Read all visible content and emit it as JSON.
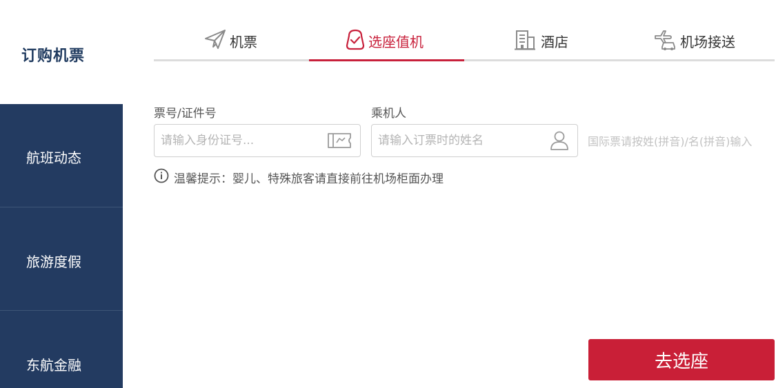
{
  "sidebar": {
    "active": {
      "label": "订购机票"
    },
    "items": [
      {
        "label": "航班动态"
      },
      {
        "label": "旅游度假"
      },
      {
        "label": "东航金融"
      }
    ]
  },
  "tabs": [
    {
      "label": "机票",
      "icon": "paper-plane-icon"
    },
    {
      "label": "选座值机",
      "icon": "seat-check-icon",
      "active": true
    },
    {
      "label": "酒店",
      "icon": "building-icon"
    },
    {
      "label": "机场接送",
      "icon": "plane-car-icon"
    }
  ],
  "form": {
    "ticket": {
      "label": "票号/证件号",
      "placeholder": "请输入身份证号...",
      "value": ""
    },
    "passenger": {
      "label": "乘机人",
      "placeholder": "请输入订票时的姓名",
      "value": ""
    },
    "intl_hint": "国际票请按姓(拼音)/名(拼音)输入",
    "tip": "温馨提示：婴儿、特殊旅客请直接前往机场柜面办理",
    "submit_label": "去选座"
  },
  "colors": {
    "sidebar_bg": "#233b61",
    "accent_red": "#c8203b",
    "button_red": "#c91f37",
    "brand_navy": "#1f3a5f"
  }
}
